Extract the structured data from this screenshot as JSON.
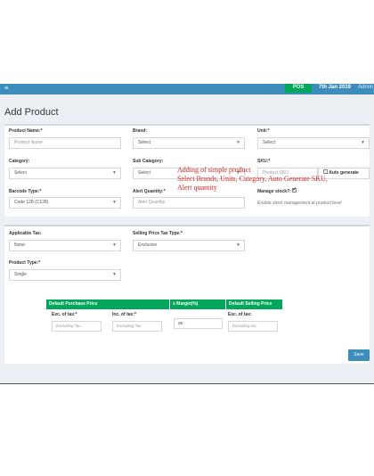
{
  "navbar": {
    "toggle_icon": "menu-icon",
    "pos_label": "POS",
    "date": "7th Jan 2019",
    "user": "Admin"
  },
  "page_title": "Add Product",
  "form": {
    "product_name_label": "Product Name:*",
    "product_name_placeholder": "Product Name",
    "brand_label": "Brand:",
    "brand_value": "Select",
    "unit_label": "Unit:*",
    "unit_value": "Select",
    "category_label": "Category:",
    "category_value": "Select",
    "sub_category_label": "Sub Category:",
    "sub_category_value": "Select",
    "sku_label": "SKU:*",
    "sku_placeholder": "Product SKU",
    "auto_generate_label": "Auto generate",
    "barcode_label": "Barcode Type:*",
    "barcode_value": "Code 128 (C128)",
    "alert_qty_label": "Alert Quantity:*",
    "alert_qty_placeholder": "Alert Quantity",
    "manage_stock_label": "Manage stock?:",
    "manage_stock_checked": true,
    "manage_stock_hint": "Enable stock management at product level",
    "tax_label": "Applicable Tax:",
    "tax_value": "None",
    "selling_tax_type_label": "Selling Price Tax Type:*",
    "selling_tax_type_value": "Exclusive",
    "product_type_label": "Product Type:*",
    "product_type_value": "Single"
  },
  "annotation": {
    "line1": "Adding of simple product",
    "line2": "Select Brands, Units, Category, Auto Generate SKU,",
    "line3": "Alert quantity"
  },
  "price_table": {
    "headers": [
      "Default Purchase Price",
      "x Margin(%)",
      "Default Selling Price"
    ],
    "exc_tax_label": "Exc. of tax:*",
    "inc_tax_label": "Inc. of tax:*",
    "exc_tax_placeholder": "Excluding Tax",
    "inc_tax_placeholder": "Excluding Tax",
    "margin_value": "25",
    "sell_exc_label": "Exc. of tax:",
    "sell_exc_placeholder": "Excluding tax"
  },
  "save_label": "Save",
  "colors": {
    "navbar": "#3c8dbc",
    "pos_button": "#00a65a",
    "table_header": "#00a65a",
    "annotation": "#e0201a",
    "background": "#ecf0f5"
  }
}
